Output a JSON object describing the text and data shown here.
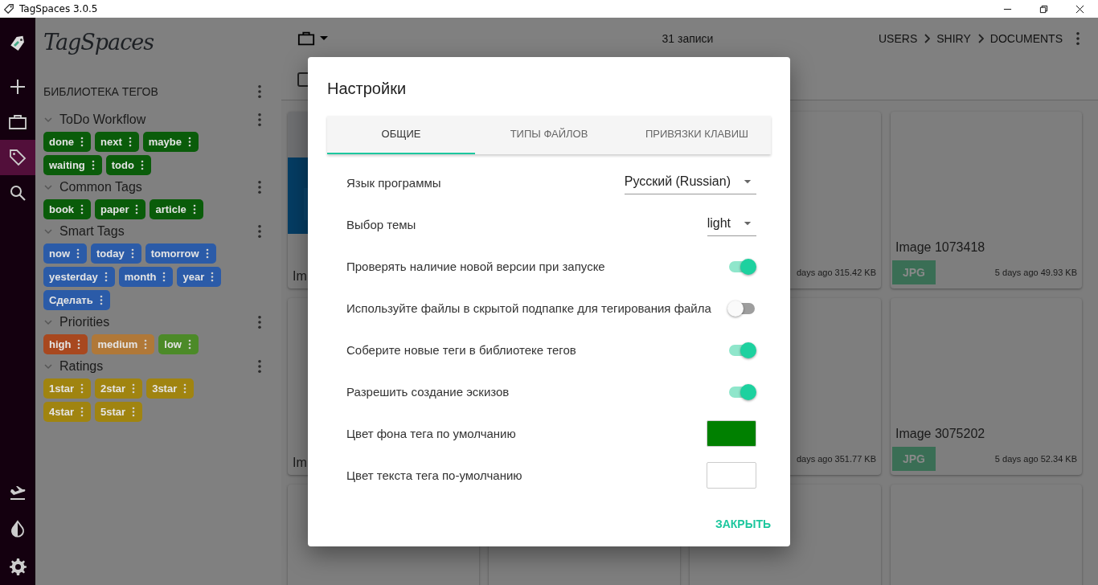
{
  "window": {
    "title": "TagSpaces 3.0.5"
  },
  "rail": [
    {
      "kind": "logo",
      "selected": false
    },
    {
      "kind": "add",
      "selected": false
    },
    {
      "kind": "locations",
      "selected": false
    },
    {
      "kind": "tags",
      "selected": true
    },
    {
      "kind": "search",
      "selected": false
    },
    {
      "kind": "import",
      "selected": false
    },
    {
      "kind": "theme",
      "selected": false
    },
    {
      "kind": "settings",
      "selected": false
    }
  ],
  "sidebar": {
    "logo": "TagSpaces",
    "heading": "БИБЛИОТЕКА ТЕГОВ",
    "groups": [
      {
        "name": "ToDo Workflow",
        "expanded": true,
        "tags": [
          {
            "label": "done",
            "color": "#0a5c0a"
          },
          {
            "label": "next",
            "color": "#0a5c0a"
          },
          {
            "label": "maybe",
            "color": "#0a5c0a"
          },
          {
            "label": "waiting",
            "color": "#0a5c0a"
          },
          {
            "label": "todo",
            "color": "#0a5c0a"
          }
        ]
      },
      {
        "name": "Common Tags",
        "expanded": true,
        "tags": [
          {
            "label": "book",
            "color": "#0a5c0a"
          },
          {
            "label": "paper",
            "color": "#0a5c0a"
          },
          {
            "label": "article",
            "color": "#0a5c0a"
          }
        ]
      },
      {
        "name": "Smart Tags",
        "expanded": true,
        "tags": [
          {
            "label": "now",
            "color": "#2b5ba8"
          },
          {
            "label": "today",
            "color": "#2b5ba8"
          },
          {
            "label": "tomorrow",
            "color": "#2b5ba8"
          },
          {
            "label": "yesterday",
            "color": "#2b5ba8"
          },
          {
            "label": "month",
            "color": "#2b5ba8"
          },
          {
            "label": "year",
            "color": "#2b5ba8"
          },
          {
            "label": "Сделать",
            "color": "#2b5ba8"
          }
        ]
      },
      {
        "name": "Priorities",
        "expanded": true,
        "tags": [
          {
            "label": "high",
            "color": "#a8481f"
          },
          {
            "label": "medium",
            "color": "#b07838"
          },
          {
            "label": "low",
            "color": "#4c8a28"
          }
        ]
      },
      {
        "name": "Ratings",
        "expanded": true,
        "tags": [
          {
            "label": "1star",
            "color": "#a08410"
          },
          {
            "label": "2star",
            "color": "#a08410"
          },
          {
            "label": "3star",
            "color": "#a08410"
          },
          {
            "label": "4star",
            "color": "#a08410"
          },
          {
            "label": "5star",
            "color": "#a08410"
          }
        ]
      }
    ]
  },
  "toolbar": {
    "count": "31 записи",
    "breadcrumbs": [
      "USERS",
      "SHIRY",
      "DOCUMENTS"
    ],
    "select_all": {
      "checked": false
    }
  },
  "grid": {
    "cards": [
      {
        "kind": "picture",
        "title": "Im"
      },
      {
        "kind": "file",
        "meta": "days ago 315.42 KB"
      },
      {
        "kind": "file",
        "title": "Image 1073418",
        "badge": "JPG",
        "meta": "5 days ago 49.93 KB"
      },
      {
        "kind": "file",
        "title": "Im"
      },
      {
        "kind": "file",
        "meta": "days ago 351.77 KB"
      },
      {
        "kind": "file",
        "title": "Image 3075202",
        "badge": "JPG",
        "meta": "5 days ago 52.34 KB"
      },
      {
        "kind": "empty"
      },
      {
        "kind": "empty"
      },
      {
        "kind": "empty"
      },
      {
        "kind": "empty"
      }
    ]
  },
  "dialog": {
    "title": "Настройки",
    "tabs": [
      {
        "label": "ОБЩИЕ",
        "selected": true
      },
      {
        "label": "ТИПЫ ФАЙЛОВ",
        "selected": false
      },
      {
        "label": "ПРИВЯЗКИ КЛАВИШ",
        "selected": false
      }
    ],
    "settings": [
      {
        "kind": "select",
        "label": "Язык программы",
        "value": "Русский (Russian)"
      },
      {
        "kind": "select",
        "label": "Выбор темы",
        "value": "light"
      },
      {
        "kind": "switch",
        "label": "Проверять наличие новой версии при запуске",
        "on": true
      },
      {
        "kind": "switch",
        "label": "Используйте файлы в скрытой подпапке для тегирования файла",
        "on": false
      },
      {
        "kind": "switch",
        "label": "Соберите новые теги в библиотеке тегов",
        "on": true
      },
      {
        "kind": "switch",
        "label": "Разрешить создание эскизов",
        "on": true
      },
      {
        "kind": "color",
        "label": "Цвет фона тега по умолчанию",
        "color": "#008000"
      },
      {
        "kind": "color",
        "label": "Цвет текста тега по-умолчанию",
        "color": "#ffffff"
      }
    ],
    "buttons": [
      "ЗАКРЫТЬ"
    ]
  }
}
